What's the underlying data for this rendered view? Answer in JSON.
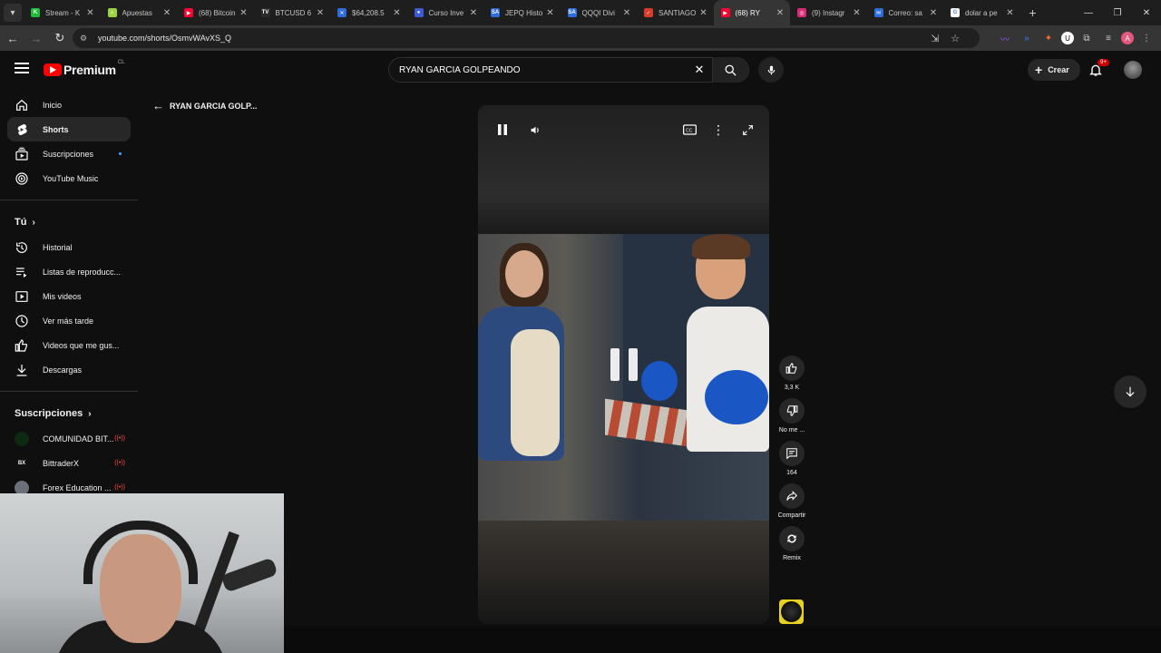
{
  "browser": {
    "tabs": [
      {
        "title": "Stream - K",
        "color": "#1fbd3a",
        "glyph": "K"
      },
      {
        "title": "Apuestas",
        "color": "#9ad33f",
        "glyph": "⚡"
      },
      {
        "title": "(68) Bitcoin",
        "color": "#ff0033",
        "glyph": "▶"
      },
      {
        "title": "BTCUSD 6",
        "color": "#2a2a2a",
        "glyph": "TV"
      },
      {
        "title": "$64,208.5",
        "color": "#2f6bdb",
        "glyph": "✕"
      },
      {
        "title": "Curso Inve",
        "color": "#3d5bd6",
        "glyph": "●"
      },
      {
        "title": "JEPQ Histo",
        "color": "#2f6bdb",
        "glyph": "SA"
      },
      {
        "title": "QQQI Divi",
        "color": "#2f6bdb",
        "glyph": "SA"
      },
      {
        "title": "SANTIAGO",
        "color": "#d93a2b",
        "glyph": "✓"
      },
      {
        "title": "(68) RY",
        "color": "#ff0033",
        "glyph": "▶",
        "active": true
      },
      {
        "title": "(9) Instagr",
        "color": "#d62976",
        "glyph": "◎"
      },
      {
        "title": "Correo: sa",
        "color": "#2f6bdb",
        "glyph": "✉"
      },
      {
        "title": "dolar a pe",
        "color": "#ffffff",
        "glyph": "G"
      }
    ],
    "url": "youtube.com/shorts/OsmvWAvXS_Q"
  },
  "header": {
    "brand": "Premium",
    "region": "CL",
    "search_query": "RYAN GARCIA GOLPEANDO",
    "create_label": "Crear",
    "notif_badge": "9+"
  },
  "sidebar": {
    "primary": [
      {
        "label": "Inicio",
        "icon": "home-icon"
      },
      {
        "label": "Shorts",
        "icon": "shorts-icon",
        "active": true
      },
      {
        "label": "Suscripciones",
        "icon": "subscriptions-icon",
        "dot": true
      },
      {
        "label": "YouTube Music",
        "icon": "music-icon"
      }
    ],
    "you_title": "Tú",
    "you_items": [
      {
        "label": "Historial",
        "icon": "history-icon"
      },
      {
        "label": "Listas de reproducc...",
        "icon": "playlists-icon"
      },
      {
        "label": "Mis videos",
        "icon": "my-videos-icon"
      },
      {
        "label": "Ver más tarde",
        "icon": "watch-later-icon"
      },
      {
        "label": "Videos que me gus...",
        "icon": "liked-icon"
      },
      {
        "label": "Descargas",
        "icon": "downloads-icon"
      }
    ],
    "subs_title": "Suscripciones",
    "subs": [
      {
        "label": "COMUNIDAD BIT...",
        "avatar_color": "#0d2a12",
        "avatar_text": "",
        "live": true
      },
      {
        "label": "BittraderX",
        "avatar_color": "#111111",
        "avatar_text": "BX",
        "live": true
      },
      {
        "label": "Forex Education ...",
        "avatar_color": "#6b7078",
        "avatar_text": "",
        "live": true
      }
    ]
  },
  "shorts": {
    "back_title": "RYAN GARCIA GOLP...",
    "likes": "3,3 K",
    "dislike_label": "No me ...",
    "comments": "164",
    "share_label": "Compartir",
    "remix_label": "Remix"
  }
}
